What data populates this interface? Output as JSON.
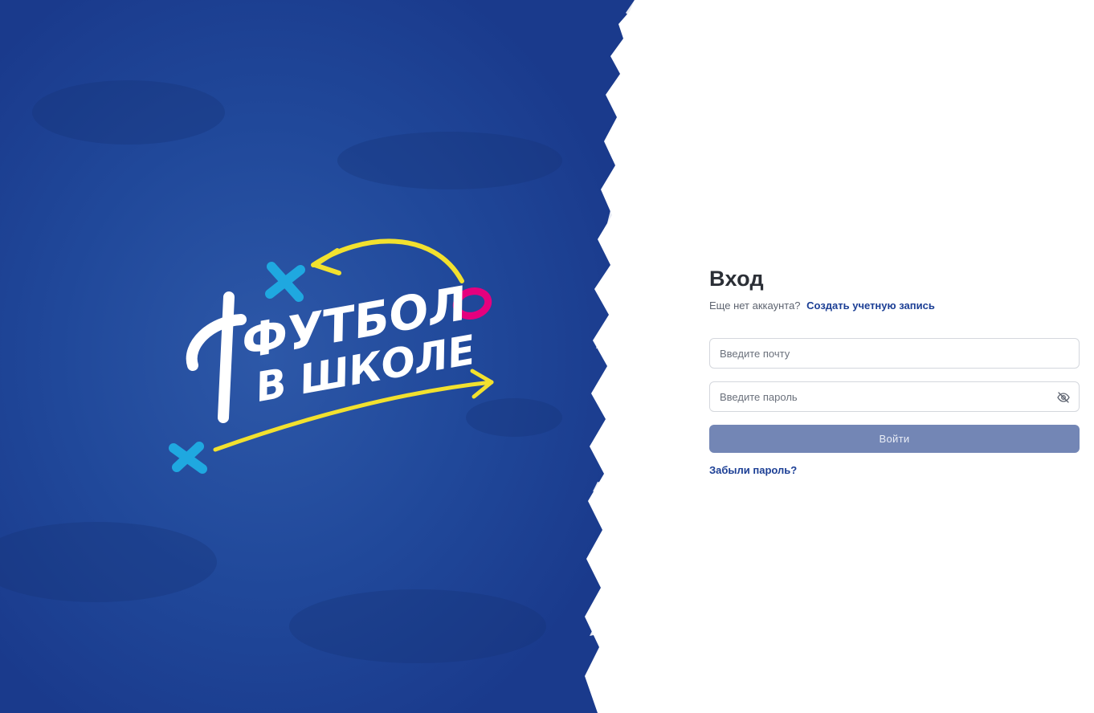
{
  "brand": {
    "logo_line1": "ФУТБОЛ",
    "logo_line2": "В ШКОЛЕ",
    "colors": {
      "background": "#1f3f96",
      "yellow": "#f2e12e",
      "cyan": "#1fa8e0",
      "magenta": "#e5007e"
    }
  },
  "login": {
    "title": "Вход",
    "no_account_text": "Еще нет аккаунта?",
    "create_account_link": "Создать учетную запись",
    "email_placeholder": "Введите почту",
    "password_placeholder": "Введите пароль",
    "password_toggle_icon": "eye-off-icon",
    "submit_label": "Войти",
    "forgot_password_link": "Забыли пароль?",
    "accent_color": "#1c3f95",
    "button_color": "#7386b5"
  }
}
